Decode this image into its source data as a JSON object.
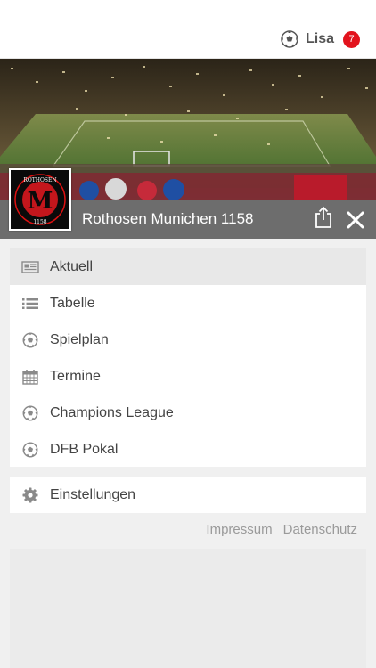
{
  "header": {
    "user_name": "Lisa",
    "notification_count": "7"
  },
  "club": {
    "name": "Rothosen Munichen 1158",
    "logo_letter": "M",
    "logo_top_text": "ROTHOSEN",
    "logo_bottom_text": "1158"
  },
  "menu": {
    "items": [
      {
        "label": "Aktuell",
        "icon": "newspaper-icon",
        "active": true
      },
      {
        "label": "Tabelle",
        "icon": "list-icon",
        "active": false
      },
      {
        "label": "Spielplan",
        "icon": "soccer-ball-icon",
        "active": false
      },
      {
        "label": "Termine",
        "icon": "calendar-icon",
        "active": false
      },
      {
        "label": "Champions League",
        "icon": "soccer-ball-icon",
        "active": false
      },
      {
        "label": "DFB Pokal",
        "icon": "soccer-ball-icon",
        "active": false
      }
    ],
    "settings_label": "Einstellungen"
  },
  "footer": {
    "impressum": "Impressum",
    "datenschutz": "Datenschutz"
  },
  "colors": {
    "accent_red": "#e2131d",
    "club_bar": "#6d6d6d",
    "active_item": "#e8e8e8"
  }
}
